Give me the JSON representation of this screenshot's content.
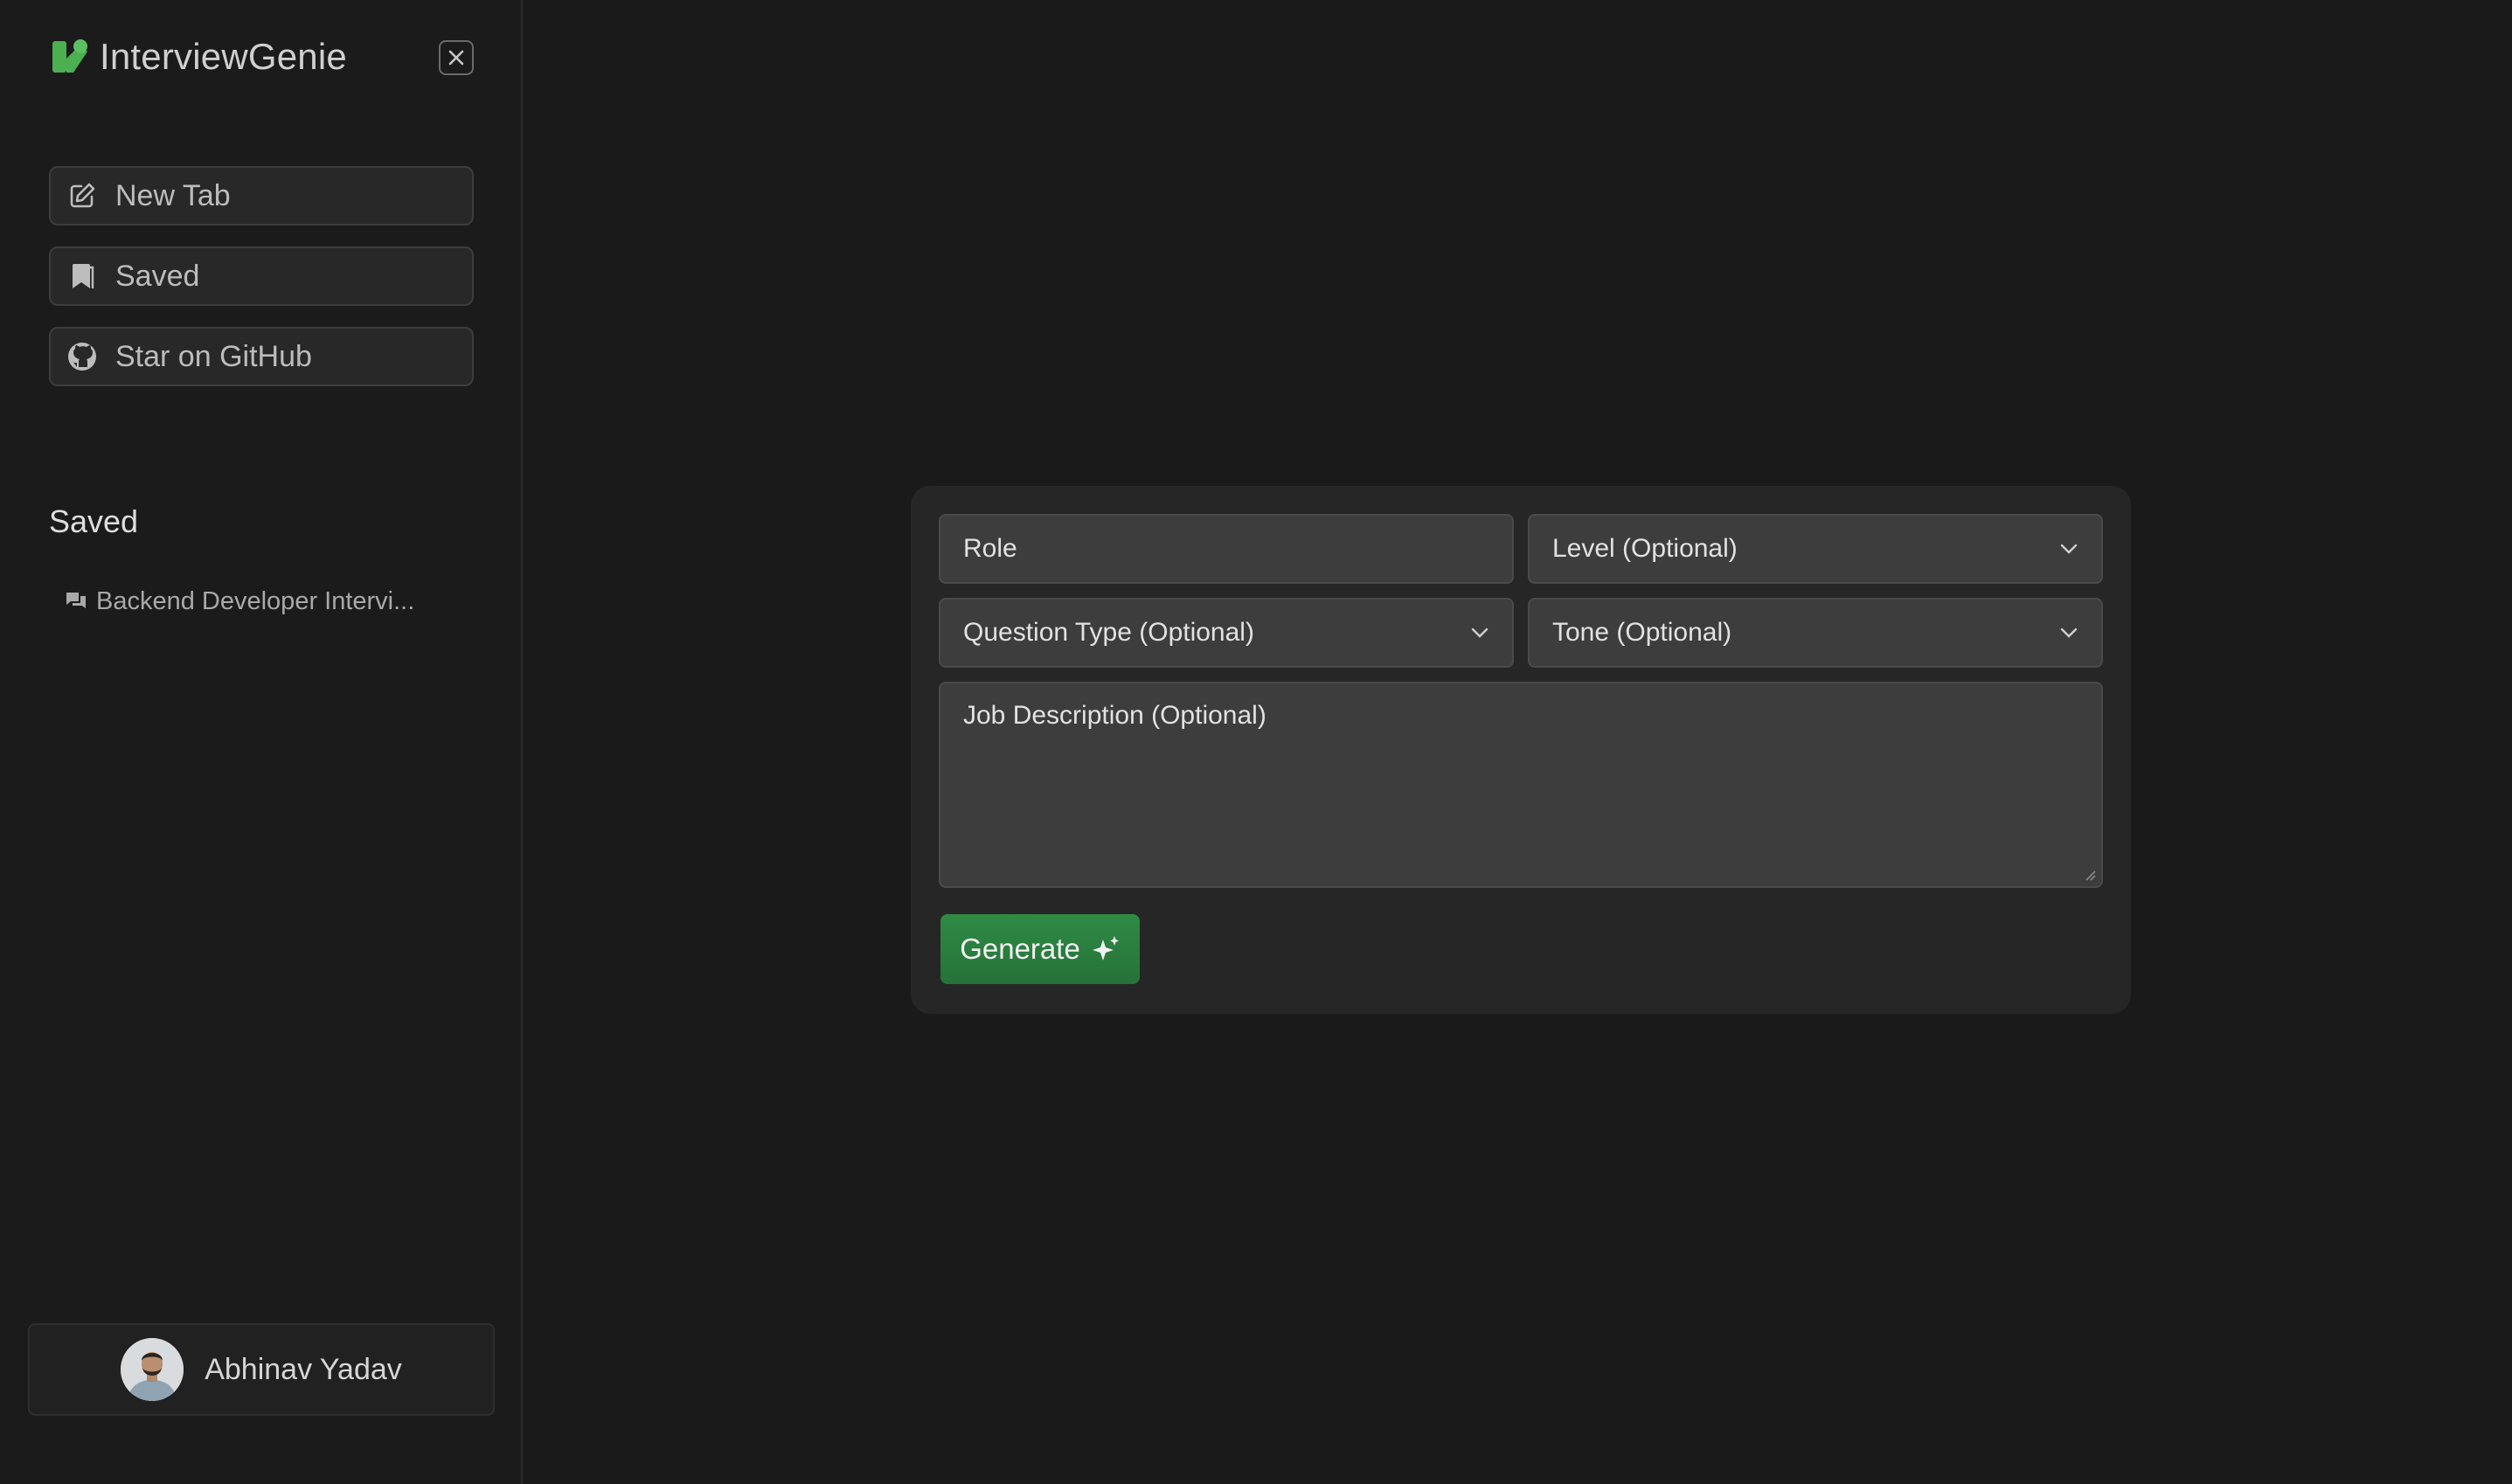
{
  "sidebar": {
    "brand": {
      "name": "InterviewGenie",
      "logo_icon": "logo-shapes-icon",
      "accent": "#4caf50"
    },
    "close_icon": "close-icon",
    "nav": [
      {
        "label": "New Tab",
        "icon": "edit-icon"
      },
      {
        "label": "Saved",
        "icon": "bookmark-icon"
      },
      {
        "label": "Star on GitHub",
        "icon": "github-icon"
      }
    ],
    "saved_heading": "Saved",
    "saved_items": [
      {
        "label": "Backend Developer Intervi...",
        "icon": "chat-icon"
      }
    ],
    "user": {
      "name": "Abhinav Yadav",
      "avatar_icon": "avatar-photo"
    }
  },
  "form": {
    "role_placeholder": "Role",
    "level_placeholder": "Level (Optional)",
    "question_type_placeholder": "Question Type (Optional)",
    "tone_placeholder": "Tone (Optional)",
    "job_description_placeholder": "Job Description (Optional)",
    "generate_label": "Generate",
    "generate_icon": "sparkles-icon",
    "generate_color": "#2b7d3f"
  }
}
